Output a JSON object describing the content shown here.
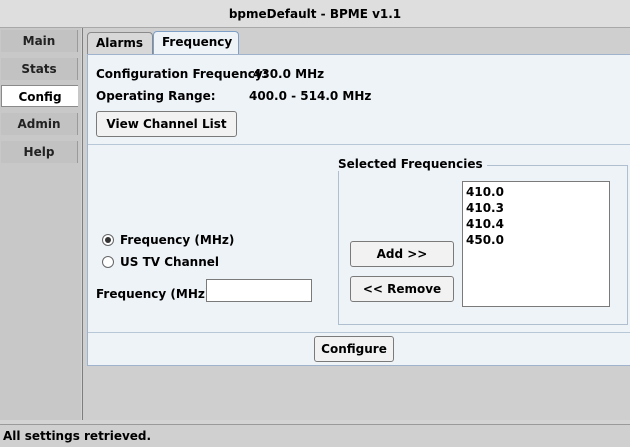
{
  "window": {
    "title": "bpmeDefault - BPME v1.1"
  },
  "nav": {
    "items": [
      {
        "label": "Main"
      },
      {
        "label": "Stats"
      },
      {
        "label": "Config"
      },
      {
        "label": "Admin"
      },
      {
        "label": "Help"
      }
    ],
    "active": "Config"
  },
  "tabs": [
    {
      "label": "Alarms"
    },
    {
      "label": "Frequency"
    }
  ],
  "active_tab": "Frequency",
  "config": {
    "config_freq_label": "Configuration Frequency:",
    "config_freq_value": "430.0 MHz",
    "range_label": "Operating Range:",
    "range_value": "400.0 - 514.0 MHz",
    "view_channel_list": "View Channel List"
  },
  "selection": {
    "radio_frequency": "Frequency (MHz)",
    "radio_tv": "US TV Channel",
    "radio_selected": "frequency",
    "freq_input_label": "Frequency (MHz):",
    "freq_input_value": "",
    "group_title": "Selected Frequencies",
    "add_button": "Add >>",
    "remove_button": "<< Remove",
    "selected_frequencies": [
      "410.0",
      "410.3",
      "410.4",
      "450.0"
    ]
  },
  "configure_button": "Configure",
  "status": "All settings retrieved."
}
